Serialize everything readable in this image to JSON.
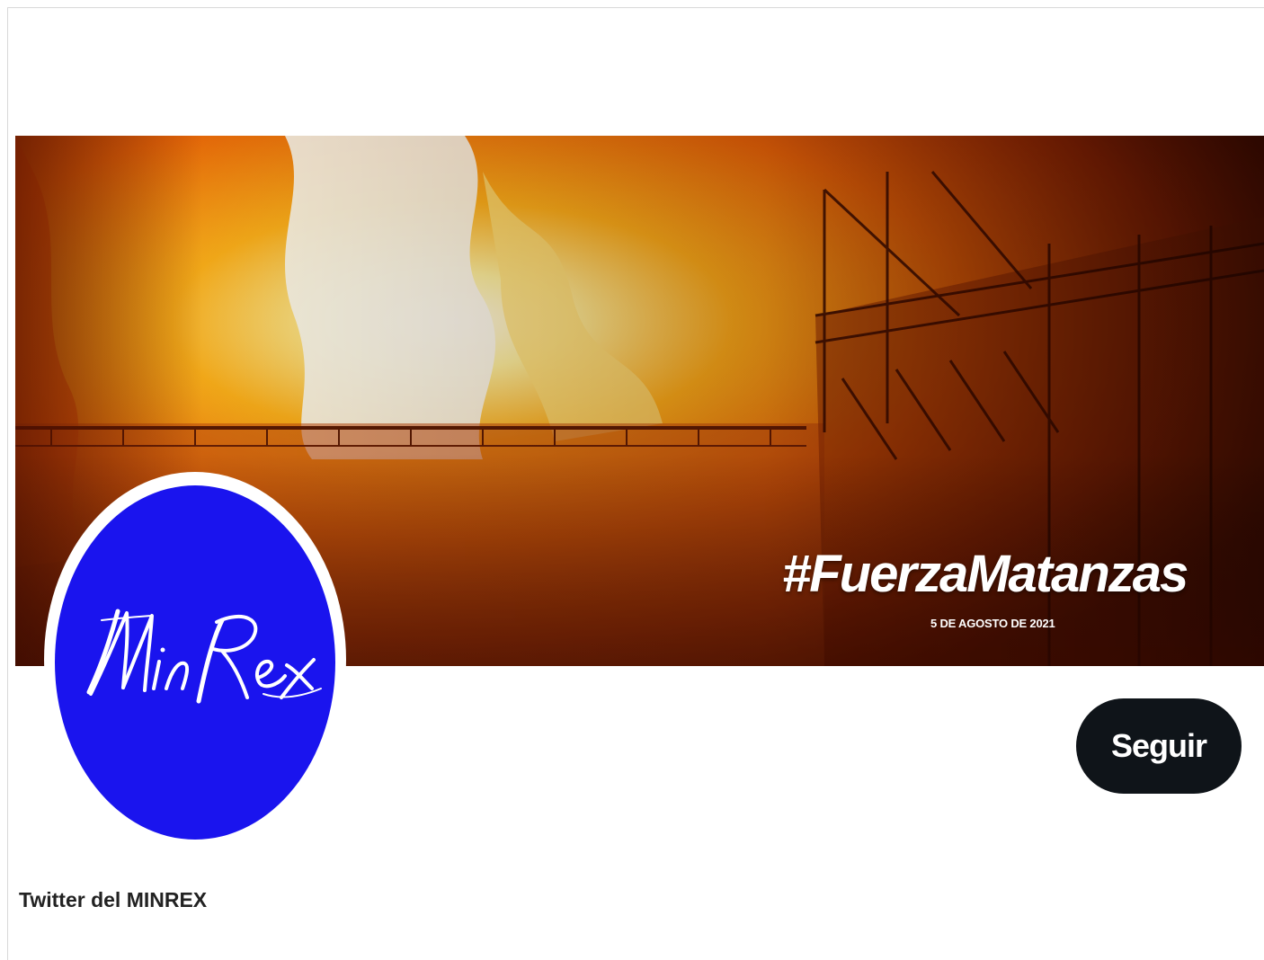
{
  "banner": {
    "hashtag": "#FuerzaMatanzas",
    "date": "5 DE AGOSTO DE 2021",
    "image": "fire-at-fuel-storage-tanks"
  },
  "avatar": {
    "logo_text": "MinRex",
    "background_color": "#1a14ee"
  },
  "profile": {
    "follow_label": "Seguir"
  },
  "caption": "Twitter del MINREX",
  "colors": {
    "button_bg": "#0f1419",
    "button_text": "#ffffff"
  }
}
